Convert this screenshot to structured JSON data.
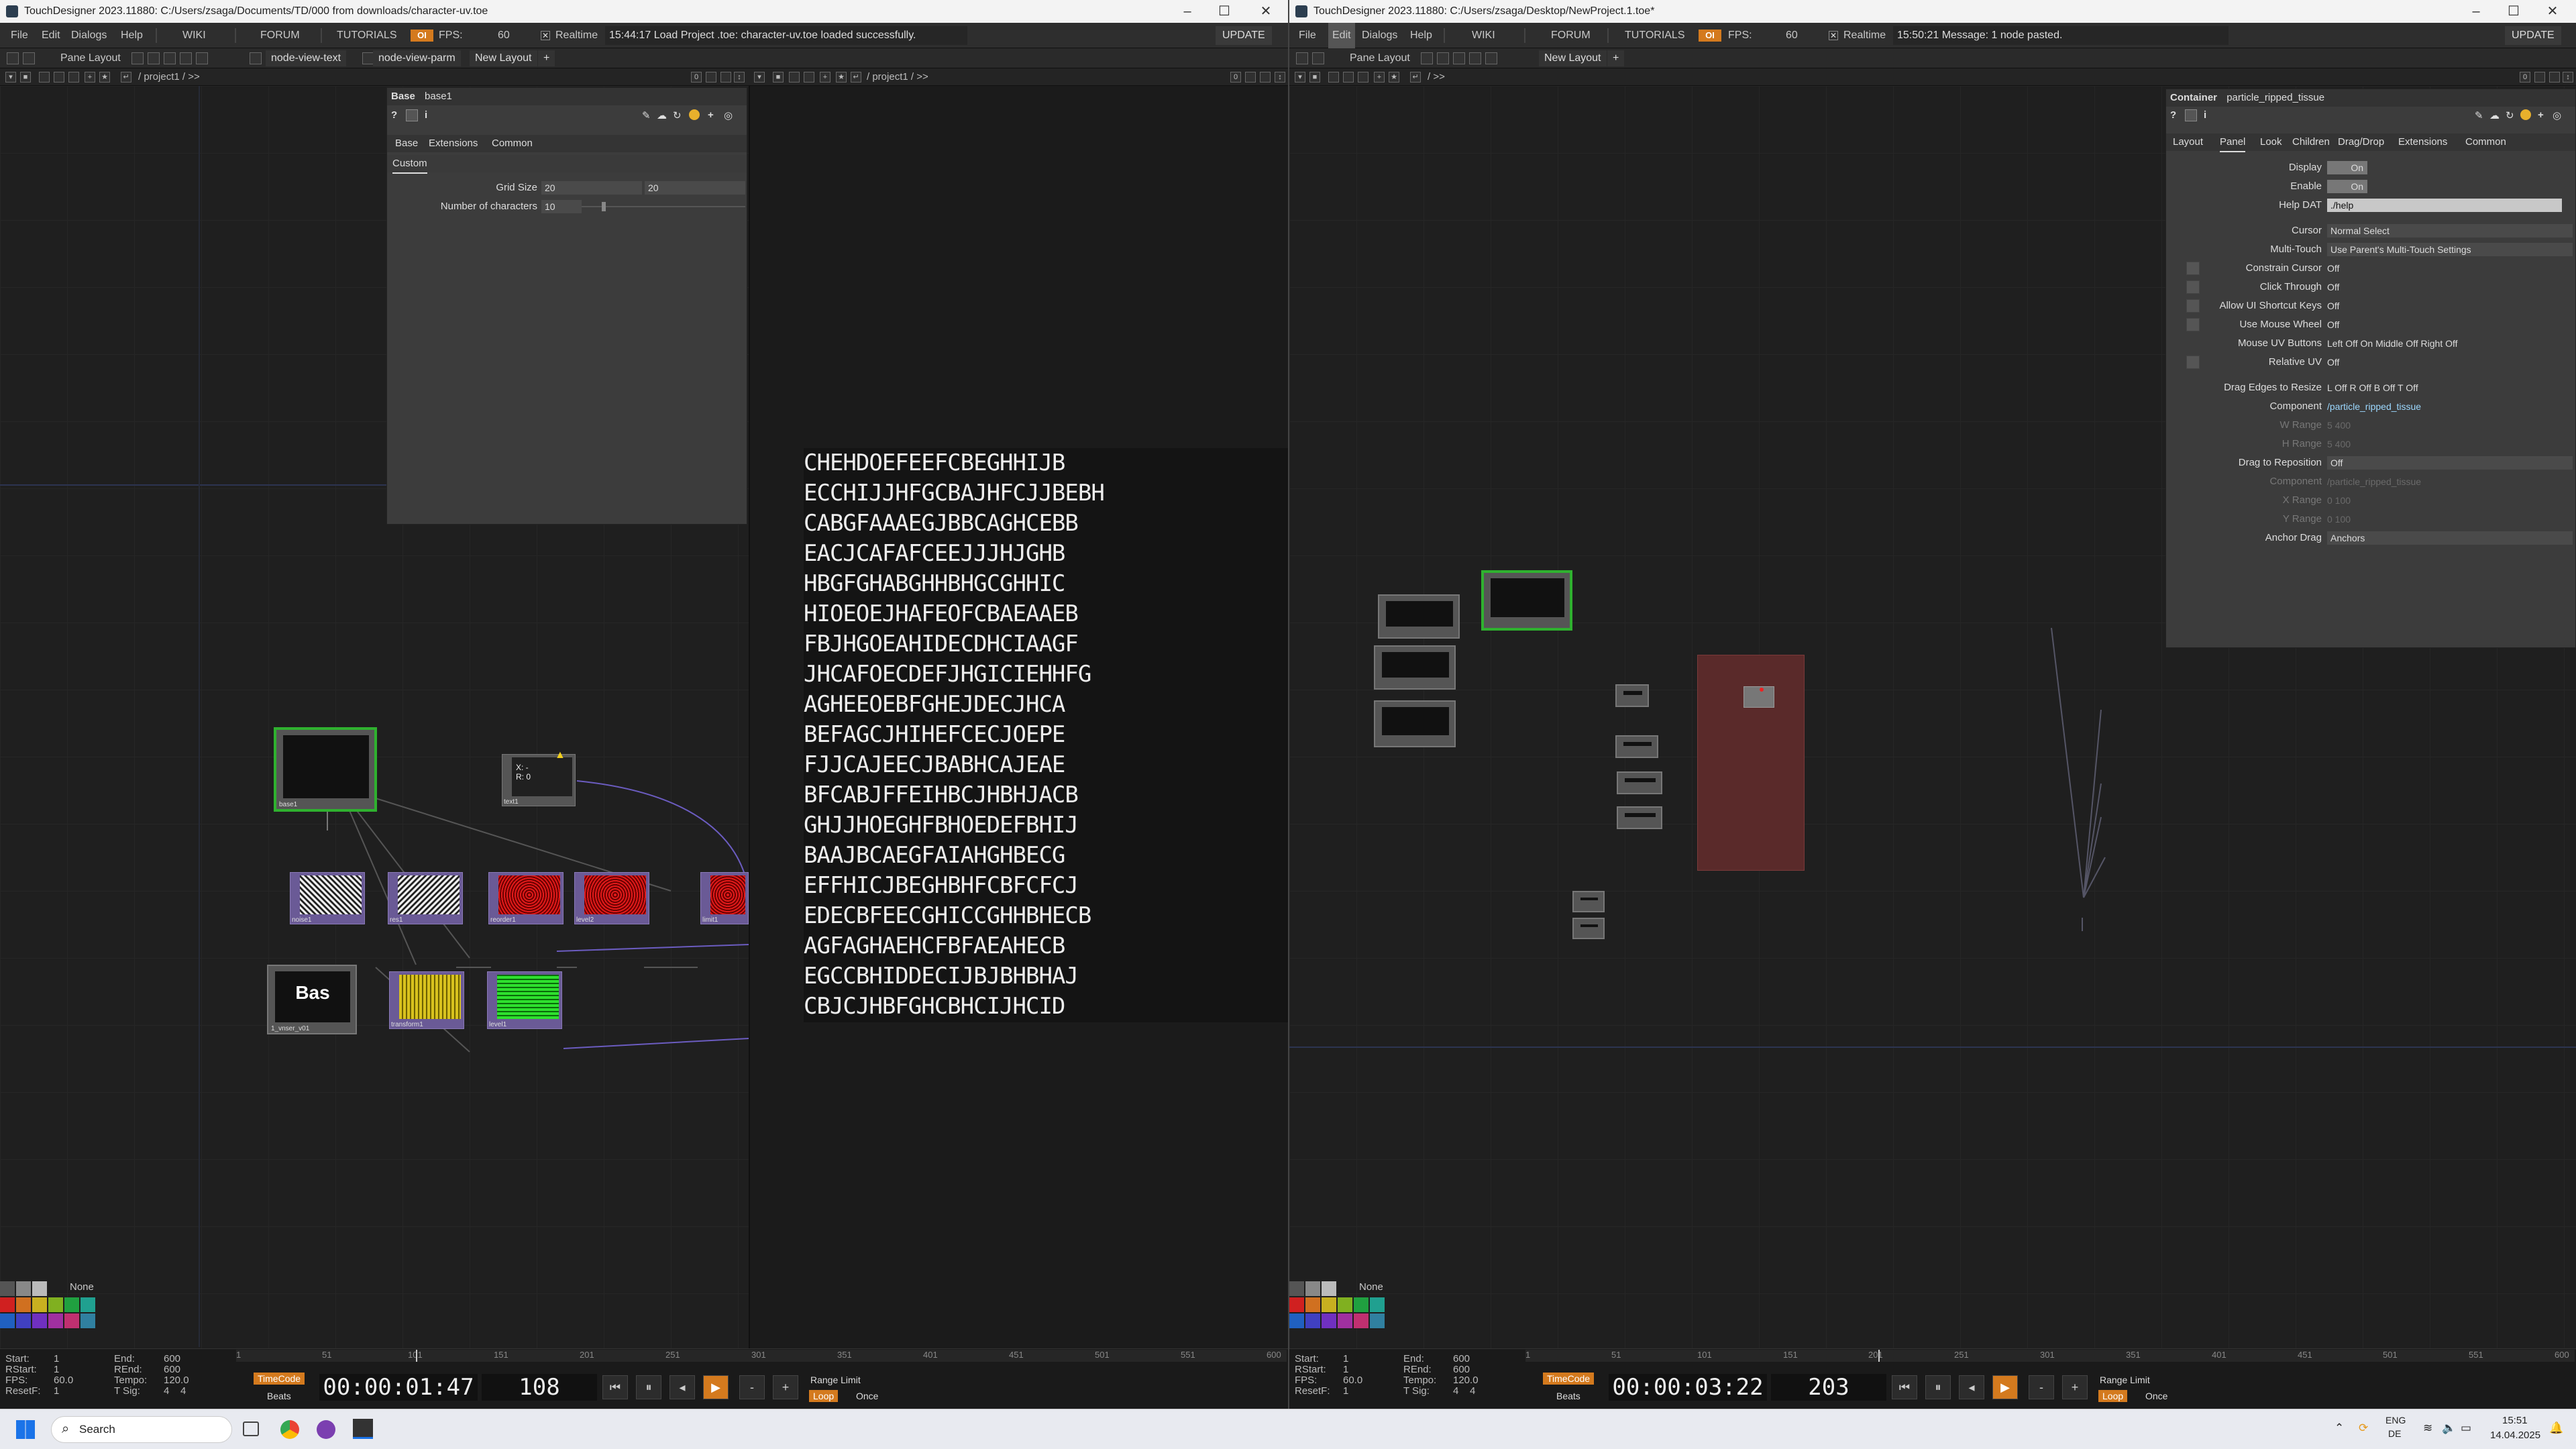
{
  "left": {
    "title": "TouchDesigner 2023.11880: C:/Users/zsaga/Documents/TD/000 from downloads/character-uv.toe",
    "menu": {
      "file": "File",
      "edit": "Edit",
      "dialogs": "Dialogs",
      "help": "Help",
      "wiki": "WIKI",
      "forum": "FORUM",
      "tutorials": "TUTORIALS",
      "oi": "OI",
      "fps_label": "FPS:",
      "fps_value": "60",
      "realtime": "Realtime",
      "message": "15:44:17 Load Project .toe: character-uv.toe loaded successfully.",
      "update": "UPDATE"
    },
    "toolbar": {
      "pane_layout": "Pane Layout",
      "tab1": "node-view-text",
      "tab2": "node-view-parm",
      "new_layout": "New Layout",
      "plus": "+"
    },
    "path1": "/ project1 / >>",
    "path2": "/ project1 / >>",
    "params": {
      "type": "Base",
      "name": "base1",
      "tabs": [
        "Base",
        "Extensions",
        "Common"
      ],
      "subtab": "Custom",
      "grid_size_label": "Grid Size",
      "grid_size_1": "20",
      "grid_size_2": "20",
      "num_chars_label": "Number of characters",
      "num_chars": "10"
    },
    "nodes": {
      "base1": "base1",
      "text1": "text1",
      "text1_line1": "X: -",
      "text1_line2": "R: 0",
      "noise1": "noise1",
      "res1": "res1",
      "reorder1": "reorder1",
      "level2": "level2",
      "limit1": "limit1",
      "bas_label": "Bas",
      "bas_name": "1_vnser_v01",
      "transform1": "transform1",
      "level1": "level1"
    },
    "glyph_rows": [
      "CHEHDOEFEEFCBEGHHIJB",
      "ECCHIJJHFGCBAJHFCJJBEBH",
      "CABGFAAAEGJBBCAGHCEBB",
      "EACJCAFAFCEEJJJHJGHB",
      "HBGFGHABGHHBHGCGHHIC",
      "HIOEOEJHAFEOFCBAEAAEB",
      "FBJHGOEAHIDECDHCIAAGF",
      "JHCAFOECDEFJHGICIEHHFG",
      "AGHEEOEBFGHEJDECJHCA",
      "BEFAGCJHIHEFCECJOEPE",
      "FJJCAJEECJBABHCAJEAE",
      "BFCABJFFEIHBCJHBHJACB",
      "GHJJHOEGHFBHOEDEFBHIJ",
      "BAAJBCAEGFAIAHGHBECG",
      "EFFHICJBEGHBHFCBFCFCJ",
      "EDECBFEECGHICCGHHBHECB",
      "AGFAGHAEHCFBFAEAHECB",
      "EGCCBHIDDECIJBJBHBHAJ",
      "CBJCJHBFGHCBHCIJHCID"
    ],
    "bottom": {
      "start_l": "Start:",
      "start_v": "1",
      "rstart_l": "RStart:",
      "rstart_v": "1",
      "fps_l": "FPS:",
      "fps_v": "60.0",
      "resetf_l": "ResetF:",
      "resetf_v": "1",
      "end_l": "End:",
      "end_v": "600",
      "rend_l": "REnd:",
      "rend_v": "600",
      "tempo_l": "Tempo:",
      "tempo_v": "120.0",
      "tsig_l": "T Sig:",
      "tsig_v": "4    4",
      "timecode": "TimeCode",
      "beats": "Beats",
      "time": "00:00:01:47",
      "frame": "108",
      "range_limit": "Range Limit",
      "loop": "Loop",
      "once": "Once",
      "none": "None",
      "ticks": [
        "1",
        "51",
        "101",
        "151",
        "201",
        "251",
        "301",
        "351",
        "401",
        "451",
        "501",
        "551",
        "600"
      ]
    }
  },
  "right": {
    "title": "TouchDesigner 2023.11880: C:/Users/zsaga/Desktop/NewProject.1.toe*",
    "menu": {
      "file": "File",
      "edit": "Edit",
      "dialogs": "Dialogs",
      "help": "Help",
      "wiki": "WIKI",
      "forum": "FORUM",
      "tutorials": "TUTORIALS",
      "oi": "OI",
      "fps_label": "FPS:",
      "fps_value": "60",
      "realtime": "Realtime",
      "message": "15:50:21 Message: 1 node pasted.",
      "update": "UPDATE"
    },
    "toolbar": {
      "pane_layout": "Pane Layout",
      "new_layout": "New Layout",
      "plus": "+"
    },
    "path1": "/ >>",
    "params": {
      "type": "Container",
      "name": "particle_ripped_tissue",
      "tabs": [
        "Layout",
        "Panel",
        "Look",
        "Children",
        "Drag/Drop",
        "Extensions",
        "Common"
      ],
      "rows": [
        {
          "label": "Display",
          "kind": "on",
          "value": "On"
        },
        {
          "label": "Enable",
          "kind": "on",
          "value": "On"
        },
        {
          "label": "Help DAT",
          "kind": "field",
          "value": "./help"
        },
        {
          "label": "Cursor",
          "kind": "menu",
          "value": "Normal Select"
        },
        {
          "label": "Multi-Touch",
          "kind": "menu",
          "value": "Use Parent's Multi-Touch Settings"
        },
        {
          "label": "Constrain Cursor",
          "kind": "off",
          "value": "Off"
        },
        {
          "label": "Click Through",
          "kind": "off",
          "value": "Off"
        },
        {
          "label": "Allow UI Shortcut Keys",
          "kind": "off",
          "value": "Off"
        },
        {
          "label": "Use Mouse Wheel",
          "kind": "off",
          "value": "Off"
        },
        {
          "label": "Mouse UV Buttons",
          "kind": "text",
          "value": "Left  Off  On     Middle  Off     Right  Off"
        },
        {
          "label": "Relative UV",
          "kind": "off",
          "value": "Off"
        },
        {
          "label": "Drag Edges to Resize",
          "kind": "text",
          "value": "L  Off     R  Off     B  Off     T  Off"
        },
        {
          "label": "Component",
          "kind": "link",
          "value": "/particle_ripped_tissue"
        },
        {
          "label": "W Range",
          "kind": "dim",
          "value": "5                         400"
        },
        {
          "label": "H Range",
          "kind": "dim",
          "value": "5                         400"
        },
        {
          "label": "Drag to Reposition",
          "kind": "menu",
          "value": "Off"
        },
        {
          "label": "Component",
          "kind": "dim",
          "value": "/particle_ripped_tissue"
        },
        {
          "label": "X Range",
          "kind": "dim",
          "value": "0                         100"
        },
        {
          "label": "Y Range",
          "kind": "dim",
          "value": "0                         100"
        },
        {
          "label": "Anchor Drag",
          "kind": "menu",
          "value": "Anchors"
        }
      ]
    },
    "bottom": {
      "start_l": "Start:",
      "start_v": "1",
      "rstart_l": "RStart:",
      "rstart_v": "1",
      "fps_l": "FPS:",
      "fps_v": "60.0",
      "resetf_l": "ResetF:",
      "resetf_v": "1",
      "end_l": "End:",
      "end_v": "600",
      "rend_l": "REnd:",
      "rend_v": "600",
      "tempo_l": "Tempo:",
      "tempo_v": "120.0",
      "tsig_l": "T Sig:",
      "tsig_v": "4    4",
      "timecode": "TimeCode",
      "beats": "Beats",
      "time": "00:00:03:22",
      "frame": "203",
      "range_limit": "Range Limit",
      "loop": "Loop",
      "once": "Once",
      "none": "None",
      "ticks": [
        "1",
        "51",
        "101",
        "151",
        "201",
        "251",
        "301",
        "351",
        "401",
        "451",
        "501",
        "551",
        "600"
      ]
    }
  },
  "taskbar": {
    "search": "Search",
    "lang1": "ENG",
    "lang2": "DE",
    "clock": "15:51",
    "date": "14.04.2025"
  },
  "colors": {
    "accent_orange": "#d47a1e",
    "selected_green": "#2fb12f",
    "node_purple": "#6a5a96"
  }
}
